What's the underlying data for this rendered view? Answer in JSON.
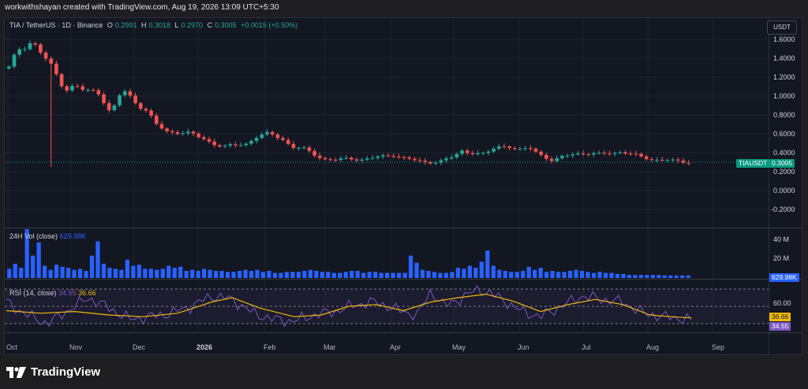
{
  "header": {
    "caption": "workwithshayan created with TradingView.com, Aug 19, 2026 13:09 UTC+5:30"
  },
  "legend": {
    "symbol": "TIA / TetherUS · 1D · Binance",
    "o_label": "O",
    "o_value": "0.2991",
    "h_label": "H",
    "h_value": "0.3018",
    "l_label": "L",
    "l_value": "0.2970",
    "c_label": "C",
    "c_value": "0.3005",
    "change": "+0.0015 (+0.50%)"
  },
  "currency_button": "USDT",
  "price_axis": [
    "1.6000",
    "1.4000",
    "1.2000",
    "1.0000",
    "0.8000",
    "0.6000",
    "0.4000",
    "0.2000",
    "0.0000",
    "-0.2000"
  ],
  "price_tag": {
    "symbol": "TIAUSDT",
    "value": "0.3005"
  },
  "volume_legend": {
    "label": "24H Vol (close)",
    "value": "629.98K"
  },
  "volume_axis": [
    "40 M",
    "20 M"
  ],
  "volume_tag": "629.98K",
  "rsi_legend": {
    "label": "RSI (14, close)",
    "rsi_value": "34.55",
    "ma_value": "36.66"
  },
  "rsi_axis": "60.00",
  "rsi_tags": {
    "ma": "36.66",
    "rsi": "34.55"
  },
  "time_axis": [
    "Oct",
    "Nov",
    "Dec",
    "2026",
    "Feb",
    "Mar",
    "Apr",
    "May",
    "Jun",
    "Jul",
    "Aug",
    "Sep"
  ],
  "brand": "TradingView",
  "colors": {
    "up": "#26a69a",
    "down": "#ef5350",
    "volume": "#2962ff",
    "rsi": "#7e57c2",
    "rsi_ma": "#f0b90b",
    "background": "#131722"
  },
  "chart_data": [
    {
      "type": "line",
      "title": "TIA / TetherUS · 1D · Binance",
      "note": "daily candlestick",
      "ylim": [
        -0.3,
        1.75
      ],
      "series": [
        {
          "name": "TIAUSDT",
          "points": [
            [
              "Oct",
              1.3
            ],
            [
              "Oct",
              1.52
            ],
            [
              "Oct",
              1.56
            ],
            [
              "Oct",
              1.45
            ],
            [
              "Oct",
              1.26
            ],
            [
              "Oct",
              1.07
            ],
            [
              "Oct",
              1.1
            ],
            [
              "Oct",
              1.05
            ],
            [
              "Nov",
              1.04
            ],
            [
              "Nov",
              0.8
            ],
            [
              "Nov",
              1.08
            ],
            [
              "Nov",
              0.95
            ],
            [
              "Nov",
              0.86
            ],
            [
              "Nov",
              0.7
            ],
            [
              "Nov",
              0.62
            ],
            [
              "Dec",
              0.62
            ],
            [
              "Dec",
              0.6
            ],
            [
              "Dec",
              0.56
            ],
            [
              "Dec",
              0.5
            ],
            [
              "Dec",
              0.46
            ],
            [
              "2026",
              0.48
            ],
            [
              "2026",
              0.5
            ],
            [
              "2026",
              0.58
            ],
            [
              "2026",
              0.6
            ],
            [
              "2026",
              0.56
            ],
            [
              "2026",
              0.46
            ],
            [
              "Feb",
              0.44
            ],
            [
              "Feb",
              0.38
            ],
            [
              "Feb",
              0.33
            ],
            [
              "Feb",
              0.32
            ],
            [
              "Feb",
              0.34
            ],
            [
              "Mar",
              0.33
            ],
            [
              "Mar",
              0.34
            ],
            [
              "Mar",
              0.36
            ],
            [
              "Mar",
              0.38
            ],
            [
              "Mar",
              0.34
            ],
            [
              "Apr",
              0.31
            ],
            [
              "Apr",
              0.3
            ],
            [
              "Apr",
              0.31
            ],
            [
              "Apr",
              0.34
            ],
            [
              "Apr",
              0.42
            ],
            [
              "May",
              0.4
            ],
            [
              "May",
              0.38
            ],
            [
              "May",
              0.46
            ],
            [
              "May",
              0.48
            ],
            [
              "May",
              0.42
            ],
            [
              "May",
              0.45
            ],
            [
              "Jun",
              0.38
            ],
            [
              "Jun",
              0.31
            ],
            [
              "Jun",
              0.36
            ],
            [
              "Jun",
              0.4
            ],
            [
              "Jun",
              0.39
            ],
            [
              "Jul",
              0.38
            ],
            [
              "Jul",
              0.4
            ],
            [
              "Jul",
              0.41
            ],
            [
              "Jul",
              0.38
            ],
            [
              "Jul",
              0.35
            ],
            [
              "Aug",
              0.33
            ],
            [
              "Aug",
              0.32
            ],
            [
              "Aug",
              0.31
            ],
            [
              "Aug",
              0.3005
            ]
          ]
        }
      ]
    },
    {
      "type": "bar",
      "title": "24H Vol (close)",
      "ylim": [
        0,
        48
      ],
      "ylabel": "M",
      "values": [
        9,
        14,
        10,
        48,
        22,
        35,
        12,
        8,
        13,
        11,
        10,
        8,
        9,
        7,
        22,
        36,
        14,
        10,
        9,
        8,
        18,
        12,
        13,
        9,
        9,
        8,
        9,
        12,
        10,
        11,
        7,
        8,
        7,
        9,
        8,
        7,
        7,
        6,
        6,
        7,
        8,
        7,
        8,
        6,
        7,
        5,
        5,
        6,
        6,
        6,
        7,
        8,
        7,
        6,
        6,
        5,
        5,
        6,
        7,
        7,
        5,
        6,
        6,
        5,
        5,
        5,
        5,
        5,
        22,
        15,
        8,
        7,
        6,
        5,
        5,
        6,
        10,
        9,
        12,
        10,
        16,
        27,
        12,
        8,
        7,
        6,
        6,
        7,
        11,
        8,
        10,
        6,
        7,
        6,
        6,
        7,
        8,
        7,
        6,
        5,
        6,
        5,
        5,
        4,
        4,
        3,
        3,
        3,
        3,
        3,
        3,
        2.5,
        2.5,
        2.5,
        2.5,
        2.5
      ]
    },
    {
      "type": "line",
      "title": "RSI (14, close)",
      "ylim": [
        20,
        80
      ],
      "series": [
        {
          "name": "RSI",
          "points": [
            [
              0,
              55
            ],
            [
              0.03,
              40
            ],
            [
              0.06,
              30
            ],
            [
              0.09,
              45
            ],
            [
              0.12,
              60
            ],
            [
              0.15,
              48
            ],
            [
              0.18,
              35
            ],
            [
              0.21,
              38
            ],
            [
              0.24,
              42
            ],
            [
              0.27,
              50
            ],
            [
              0.3,
              62
            ],
            [
              0.33,
              58
            ],
            [
              0.36,
              42
            ],
            [
              0.39,
              35
            ],
            [
              0.42,
              33
            ],
            [
              0.45,
              40
            ],
            [
              0.48,
              44
            ],
            [
              0.51,
              52
            ],
            [
              0.54,
              55
            ],
            [
              0.57,
              46
            ],
            [
              0.6,
              40
            ],
            [
              0.62,
              68
            ],
            [
              0.64,
              50
            ],
            [
              0.66,
              58
            ],
            [
              0.69,
              70
            ],
            [
              0.72,
              60
            ],
            [
              0.75,
              45
            ],
            [
              0.78,
              38
            ],
            [
              0.81,
              50
            ],
            [
              0.84,
              62
            ],
            [
              0.87,
              58
            ],
            [
              0.9,
              55
            ],
            [
              0.93,
              42
            ],
            [
              0.96,
              38
            ],
            [
              1.0,
              34.55
            ]
          ]
        },
        {
          "name": "RSI MA",
          "points": [
            [
              0,
              45
            ],
            [
              0.05,
              42
            ],
            [
              0.1,
              44
            ],
            [
              0.15,
              40
            ],
            [
              0.2,
              38
            ],
            [
              0.25,
              42
            ],
            [
              0.3,
              55
            ],
            [
              0.33,
              60
            ],
            [
              0.37,
              48
            ],
            [
              0.42,
              38
            ],
            [
              0.46,
              40
            ],
            [
              0.5,
              50
            ],
            [
              0.54,
              52
            ],
            [
              0.58,
              45
            ],
            [
              0.62,
              55
            ],
            [
              0.66,
              60
            ],
            [
              0.7,
              64
            ],
            [
              0.74,
              56
            ],
            [
              0.78,
              44
            ],
            [
              0.82,
              52
            ],
            [
              0.86,
              58
            ],
            [
              0.9,
              52
            ],
            [
              0.94,
              40
            ],
            [
              0.97,
              38
            ],
            [
              1.0,
              36.66
            ]
          ]
        }
      ]
    }
  ]
}
